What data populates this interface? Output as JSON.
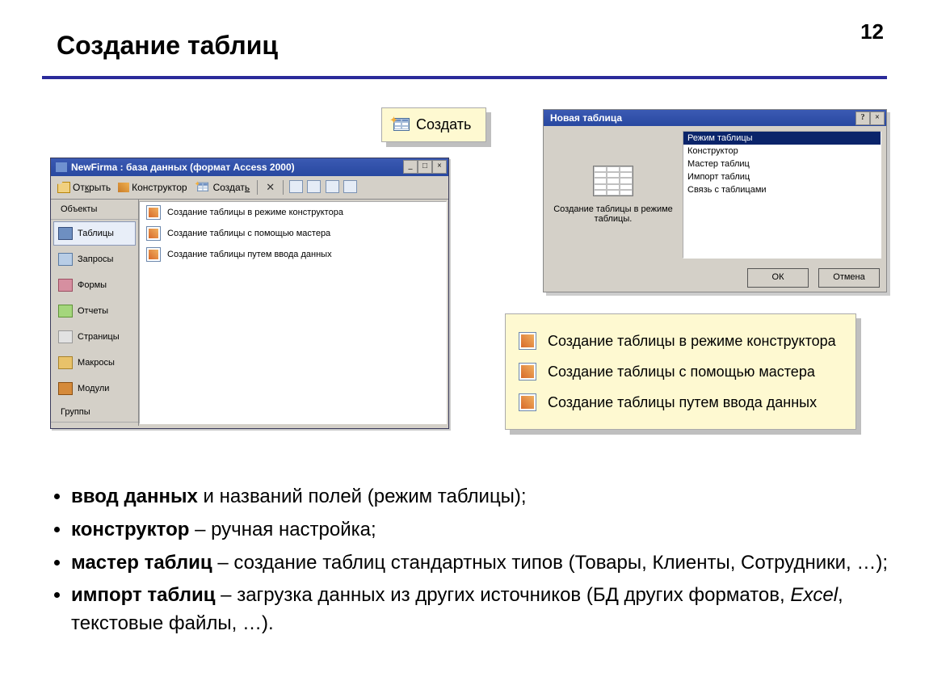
{
  "slide": {
    "page_number": "12",
    "title": "Создание таблиц"
  },
  "callout_create": {
    "label": "Создать"
  },
  "access_window": {
    "title": "NewFirma : база данных (формат Access 2000)",
    "toolbar": {
      "open": "Открыть",
      "design": "Конструктор",
      "create": "Создать"
    },
    "sidebar": {
      "objects_header": "Объекты",
      "groups_header": "Группы",
      "items": [
        "Таблицы",
        "Запросы",
        "Формы",
        "Отчеты",
        "Страницы",
        "Макросы",
        "Модули"
      ]
    },
    "list": [
      "Создание таблицы в режиме конструктора",
      "Создание таблицы с помощью мастера",
      "Создание таблицы путем ввода данных"
    ]
  },
  "dialog": {
    "title": "Новая таблица",
    "preview_text": "Создание таблицы в режиме таблицы.",
    "options": [
      "Режим таблицы",
      "Конструктор",
      "Мастер таблиц",
      "Импорт таблиц",
      "Связь с таблицами"
    ],
    "ok": "ОК",
    "cancel": "Отмена"
  },
  "callout_wizard": [
    "Создание таблицы в режиме конструктора",
    "Создание таблицы с помощью мастера",
    "Создание таблицы путем ввода данных"
  ],
  "bullets": {
    "b1_strong": "ввод данных",
    "b1_rest": " и названий полей (режим таблицы);",
    "b2_strong": "конструктор",
    "b2_rest": " – ручная настройка;",
    "b3_strong": "мастер таблиц",
    "b3_rest": " – создание таблиц стандартных типов (Товары, Клиенты, Сотрудники, …);",
    "b4_strong": "импорт таблиц",
    "b4_rest_a": " – загрузка данных из других источников (БД других форматов, ",
    "b4_em": "Excel",
    "b4_rest_b": ", текстовые файлы, …)."
  }
}
